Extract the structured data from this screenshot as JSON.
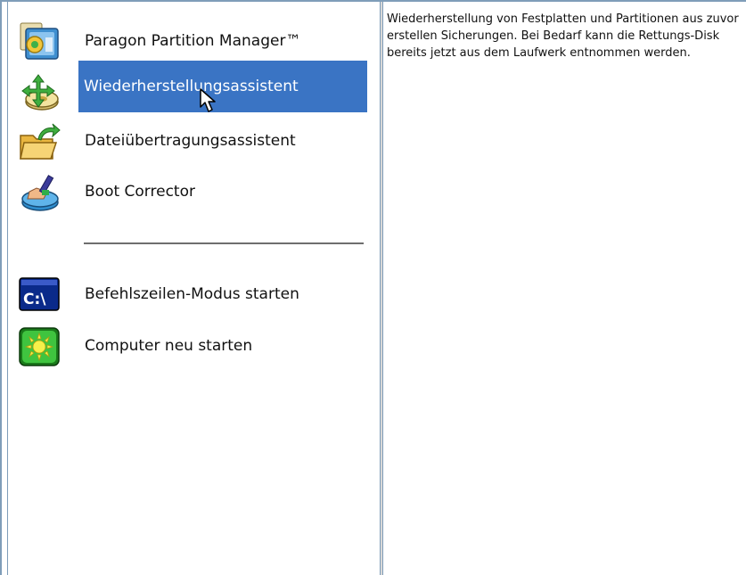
{
  "menu": {
    "items": [
      {
        "label": "Paragon Partition Manager™",
        "icon": "partition-manager-icon"
      },
      {
        "label": "Wiederherstellungsassistent",
        "icon": "restore-wizard-icon",
        "selected": true
      },
      {
        "label": "Dateiübertragungsassistent",
        "icon": "file-transfer-icon"
      },
      {
        "label": "Boot Corrector",
        "icon": "boot-corrector-icon"
      }
    ],
    "system_items": [
      {
        "label": "Befehlszeilen-Modus starten",
        "icon": "command-line-icon",
        "icon_text": "C:\\"
      },
      {
        "label": "Computer neu starten",
        "icon": "restart-computer-icon"
      }
    ]
  },
  "description": {
    "text": "Wiederherstellung von Festplatten und Partitionen aus zuvor erstellen Sicherungen. Bei Bedarf kann die Rettungs-Disk bereits jetzt aus dem Laufwerk entnommen werden."
  },
  "colors": {
    "selection": "#3a74c4",
    "border": "#7f9db9"
  }
}
